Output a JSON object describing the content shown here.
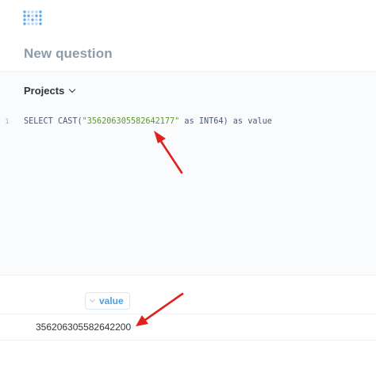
{
  "header": {
    "logo_icon": "metabase-logo-icon",
    "title": "New question"
  },
  "database_picker": {
    "selected": "Projects"
  },
  "editor": {
    "line_numbers": [
      "1"
    ],
    "query": {
      "kw_select": "SELECT",
      "fn_cast": "CAST(",
      "string_literal": "\"356206305582642177\"",
      "kw_as1": " as ",
      "type": "INT64)",
      "kw_as2": " as ",
      "alias": "value"
    }
  },
  "results": {
    "columns": [
      {
        "label": "value"
      }
    ],
    "rows": [
      [
        "356206305582642200"
      ]
    ]
  },
  "colors": {
    "accent": "#509ee3",
    "string": "#5a9a2b",
    "annotation_arrow": "#e0211d"
  }
}
